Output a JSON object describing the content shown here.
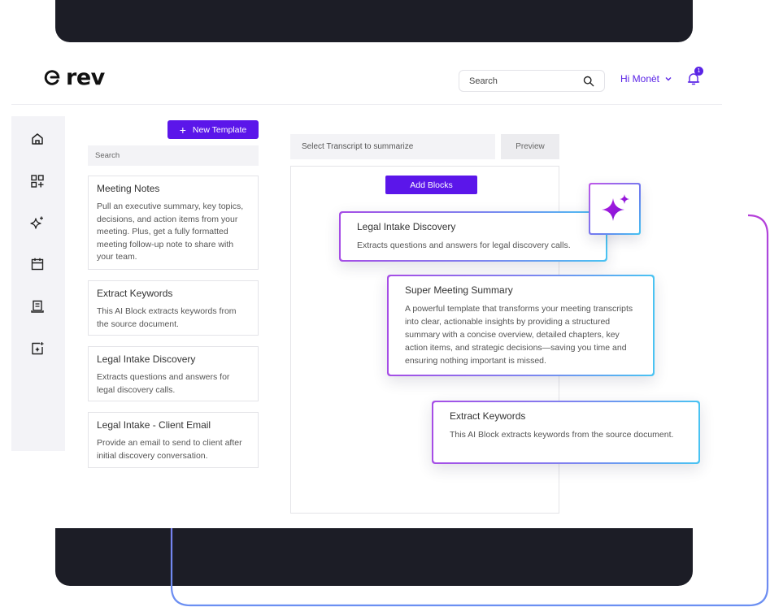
{
  "header": {
    "logo_text": "rev",
    "search_placeholder": "Search",
    "user_greeting": "Hi Monèt",
    "notification_count": "1"
  },
  "sidebar": {
    "icons": [
      "home-icon",
      "apps-add-icon",
      "sparkles-icon",
      "calendar-icon",
      "transcript-icon",
      "ai-document-icon"
    ]
  },
  "templates": {
    "new_template_label": "New Template",
    "search_placeholder": "Search",
    "items": [
      {
        "title": "Meeting Notes",
        "description": "Pull an executive summary, key topics, decisions, and action items from your meeting. Plus, get a fully formatted meeting follow-up note to share with your team."
      },
      {
        "title": "Extract Keywords",
        "description": "This AI Block extracts keywords from the source document."
      },
      {
        "title": "Legal Intake Discovery",
        "description": "Extracts questions and answers for legal discovery calls."
      },
      {
        "title": "Legal Intake - Client Email",
        "description": "Provide an email to send to client after initial discovery conversation."
      }
    ]
  },
  "editor": {
    "select_transcript_label": "Select Transcript to summarize",
    "preview_label": "Preview",
    "add_blocks_label": "Add Blocks"
  },
  "floating_blocks": [
    {
      "title": "Legal Intake Discovery",
      "description": "Extracts questions and answers for legal discovery calls."
    },
    {
      "title": "Super Meeting Summary",
      "description": "A powerful template that transforms your meeting transcripts into clear, actionable insights by providing a structured summary with a concise overview, detailed chapters, key action items, and strategic decisions—saving you time and ensuring nothing important is missed."
    },
    {
      "title": "Extract Keywords",
      "description": "This AI Block extracts keywords from the source document."
    }
  ],
  "colors": {
    "brand": "#5b16ea",
    "dark_band": "#1c1d26",
    "gradient_start": "#a64de6",
    "gradient_end": "#49c3f2"
  }
}
